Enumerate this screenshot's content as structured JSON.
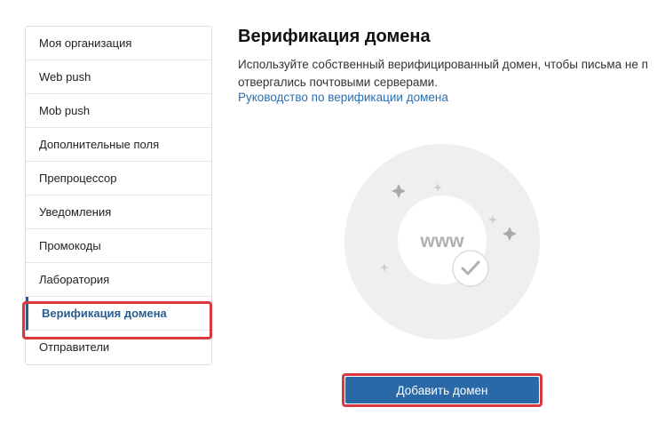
{
  "sidebar": {
    "items": [
      {
        "label": "Моя организация"
      },
      {
        "label": "Web push"
      },
      {
        "label": "Mob push"
      },
      {
        "label": "Дополнительные поля"
      },
      {
        "label": "Препроцессор"
      },
      {
        "label": "Уведомления"
      },
      {
        "label": "Промокоды"
      },
      {
        "label": "Лаборатория"
      },
      {
        "label": "Верификация домена",
        "active": true
      },
      {
        "label": "Отправители"
      }
    ]
  },
  "main": {
    "title": "Верификация домена",
    "description_line1": "Используйте собственный верифицированный домен, чтобы письма не п",
    "description_line2": "отвергались почтовыми серверами.",
    "guide_link": "Руководство по верификации домена",
    "illustration_text": "www",
    "add_button_label": "Добавить домен"
  },
  "colors": {
    "accent": "#2a5d8f",
    "link": "#2a6fb5",
    "button": "#2a69a7",
    "highlight": "#d9393e"
  }
}
